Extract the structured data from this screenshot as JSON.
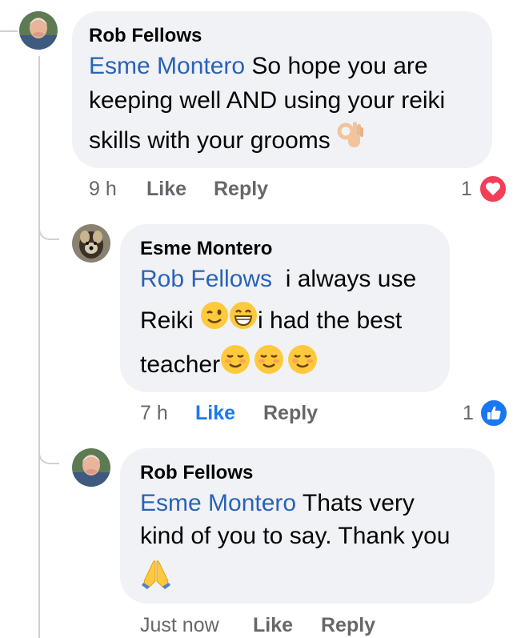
{
  "comments": [
    {
      "author": "Rob Fellows",
      "mention": "Esme Montero",
      "lines": [
        " So hope you are",
        "keeping well AND using your reiki",
        "skills with your grooms"
      ],
      "emoji": [
        "ok-hand"
      ],
      "time": "9 h",
      "like_label": "Like",
      "reply_label": "Reply",
      "reaction_count": "1",
      "reaction_type": "love",
      "reaction_color": "#f33e58"
    },
    {
      "author": "Esme Montero",
      "mention": "Rob Fellows",
      "lines": [
        "  i always use",
        "Reiki ",
        "i had the best",
        "teacher"
      ],
      "emoji": [
        "winking-face",
        "grinning-face",
        "smiling-face",
        "smiling-face",
        "smiling-face"
      ],
      "time": "7 h",
      "like_label": "Like",
      "reply_label": "Reply",
      "liked": true,
      "reaction_count": "1",
      "reaction_type": "like",
      "reaction_color": "#1a77f2"
    },
    {
      "author": "Rob Fellows",
      "mention": "Esme Montero",
      "lines": [
        " Thats very",
        "kind of you to say. Thank you"
      ],
      "emoji": [
        "folded-hands"
      ],
      "time": "Just now",
      "like_label": "Like",
      "reply_label": "Reply"
    }
  ],
  "colors": {
    "bubble": "#f0f2f5",
    "mention": "#2a62b8",
    "meta": "#65676b",
    "like_active": "#1a77f2"
  }
}
